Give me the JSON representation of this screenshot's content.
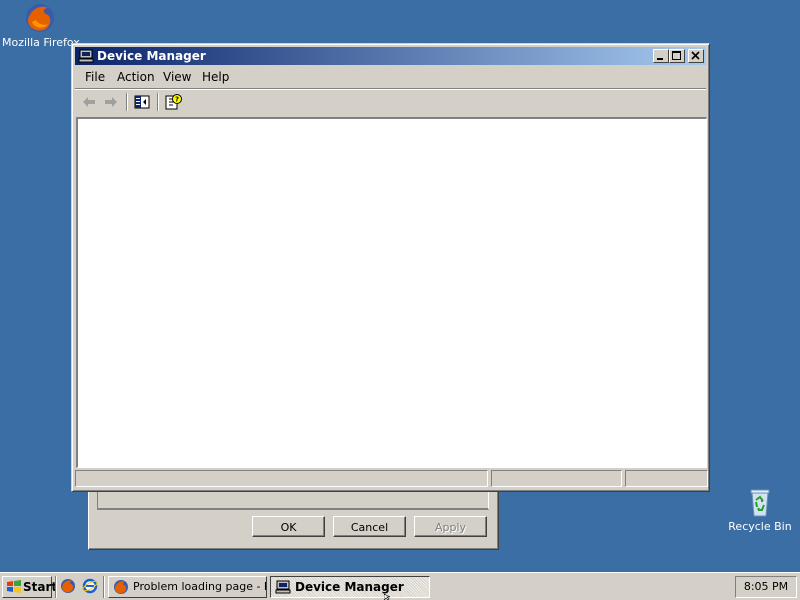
{
  "desktop": {
    "icons": [
      {
        "label": "Mozilla Firefox",
        "icon": "firefox-icon"
      },
      {
        "label": "Recycle Bin",
        "icon": "recycle-bin-icon"
      }
    ]
  },
  "background_dialog": {
    "buttons": {
      "ok": "OK",
      "cancel": "Cancel",
      "apply": "Apply"
    },
    "apply_disabled": true
  },
  "window": {
    "title": "Device Manager",
    "menus": [
      "File",
      "Action",
      "View",
      "Help"
    ],
    "toolbar": [
      "back-arrow-icon",
      "forward-arrow-icon",
      "show-hide-console-tree-icon",
      "help-icon"
    ]
  },
  "taskbar": {
    "start_label": "Start",
    "quick_launch": [
      "firefox-icon",
      "internet-explorer-icon"
    ],
    "tasks": [
      {
        "label": "Problem loading page - M...",
        "icon": "firefox-icon",
        "active": false
      },
      {
        "label": "Device Manager",
        "icon": "computer-icon",
        "active": true
      }
    ],
    "clock": "8:05 PM"
  },
  "colors": {
    "desktop": "#3a6ea5",
    "titlebar_start": "#0a246a",
    "titlebar_end": "#a6caf0",
    "face": "#d4d0c8"
  }
}
